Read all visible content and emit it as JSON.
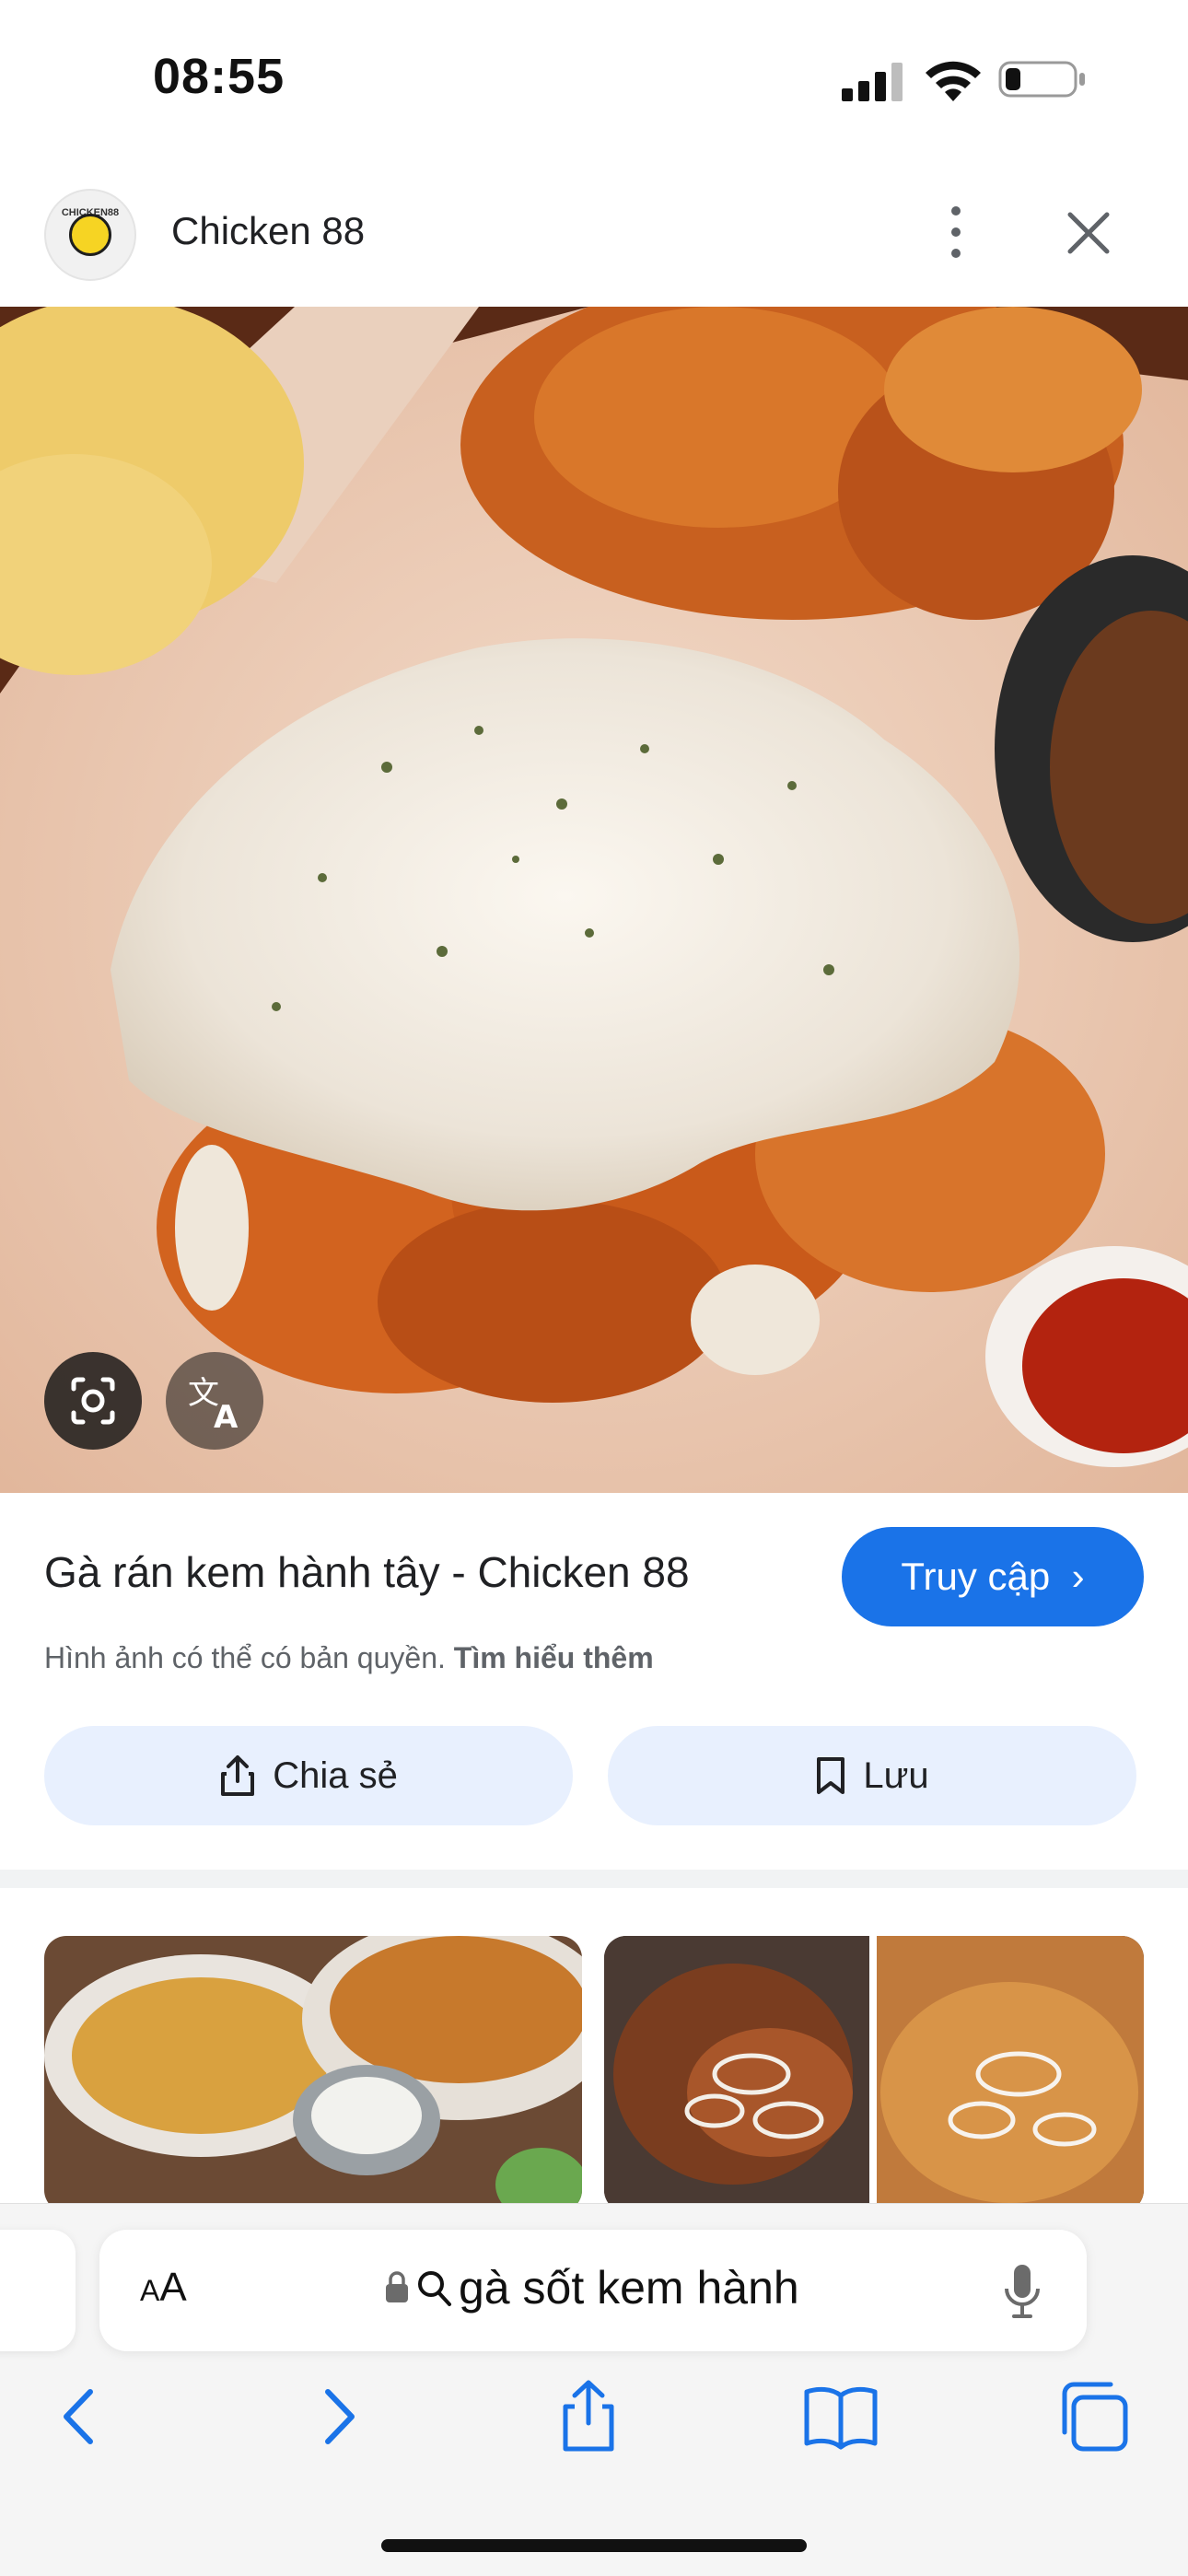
{
  "status_bar": {
    "time": "08:55",
    "battery_level": 0.2
  },
  "source": {
    "name": "Chicken 88",
    "favicon_text": "CHICKEN88"
  },
  "result": {
    "title": "Gà rán kem hành tây - Chicken 88",
    "visit_label": "Truy cập",
    "copyright_text": "Hình ảnh có thể có bản quyền.",
    "learn_more": "Tìm hiểu thêm",
    "share_label": "Chia sẻ",
    "save_label": "Lưu"
  },
  "browser": {
    "aa_small": "A",
    "aa_large": "A",
    "url_text": "gà sốt kem hành"
  },
  "icons": {
    "lens": "lens-icon",
    "translate": "translate-icon",
    "share": "share-icon",
    "bookmark": "bookmark-icon",
    "back": "back-icon",
    "forward": "forward-icon",
    "safari_share": "safari-share-icon",
    "bookmarks": "bookmarks-book-icon",
    "tabs": "tabs-icon"
  },
  "colors": {
    "accent": "#1a73e8",
    "pill_bg": "#e8f0fe"
  }
}
